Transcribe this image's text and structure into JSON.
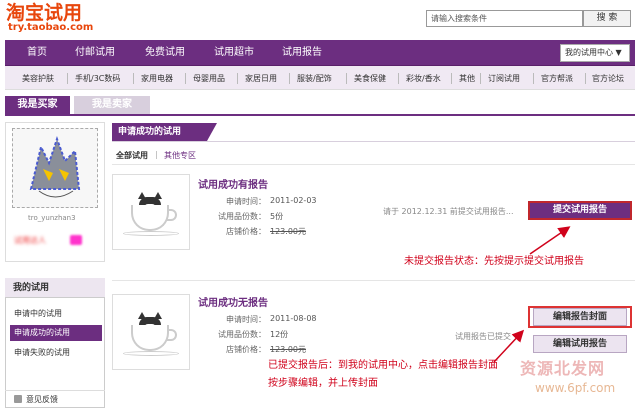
{
  "logo": {
    "cn": "淘宝试用",
    "en": "try.taobao.com"
  },
  "search": {
    "placeholder": "请输入搜索条件",
    "button": "搜 索"
  },
  "nav": {
    "items": [
      "首页",
      "付邮试用",
      "免费试用",
      "试用超市",
      "试用报告"
    ],
    "user_center": "我的试用中心 ▼"
  },
  "subnav": {
    "items": [
      "美容护肤",
      "手机/3C数码",
      "家用电器",
      "母婴用品",
      "家居日用",
      "服装/配饰",
      "美食保健",
      "彩妆/香水",
      "其他",
      "订阅试用",
      "官方帮派",
      "官方论坛"
    ]
  },
  "tabs": {
    "buyer": "我是买家",
    "seller": "我是卖家"
  },
  "profile": {
    "username": "tro_yunzhan3",
    "level": "试用达人"
  },
  "my_trial": {
    "title": "我的试用",
    "items": [
      "申请中的试用",
      "申请成功的试用",
      "申请失败的试用"
    ],
    "active_index": 1,
    "feedback": "意见反馈"
  },
  "main": {
    "header": "申请成功的试用",
    "filter_all": "全部试用",
    "filter_sep": "|",
    "filter_other": "其他专区"
  },
  "items": [
    {
      "title": "试用成功有报告",
      "apply_time_label": "申请时间：",
      "apply_time": "2011-02-03",
      "qty_label": "试用品份数：",
      "qty": "5份",
      "price_label": "店铺价格：",
      "price": "123.00元",
      "status": "请于 2012.12.31 前提交试用报告...",
      "button": "提交试用报告"
    },
    {
      "title": "试用成功无报告",
      "apply_time_label": "申请时间：",
      "apply_time": "2011-08-08",
      "qty_label": "试用品份数：",
      "qty": "12份",
      "price_label": "店铺价格：",
      "price": "123.00元",
      "status": "试用报告已提交",
      "button_cover": "编辑报告封面",
      "button_edit": "编辑试用报告"
    }
  ],
  "annotations": {
    "a1": "未提交报告状态：先按提示提交试用报告",
    "a2_line1": "已提交报告后：到我的试用中心，点击编辑报告封面",
    "a2_line2": "按步骤编辑，并上传封面"
  },
  "watermark": {
    "line1": "资源北发网",
    "line2": "www.6pf.com"
  },
  "colors": {
    "brand": "#6c2e80",
    "logo": "#e8460c",
    "annotation": "#d0021b"
  }
}
